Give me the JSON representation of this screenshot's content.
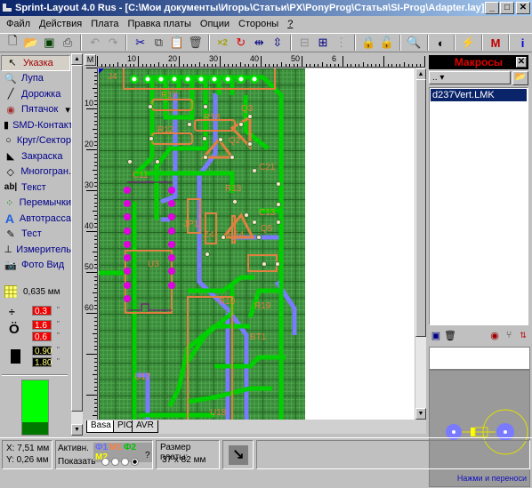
{
  "window": {
    "title": "Sprint-Layout 4.0 Rus - [C:\\Мои документы\\Игорь\\Статьи\\PX\\PonyProg\\Статья\\SI-Prog\\Adapter.lay]",
    "minimize": "_",
    "maximize": "□",
    "close": "✕"
  },
  "menu": [
    "Файл",
    "Действия",
    "Плата",
    "Правка платы",
    "Опции",
    "Стороны",
    "?"
  ],
  "toolbar": [
    {
      "name": "new-file-icon",
      "glyph": "🗋",
      "color": "#000000"
    },
    {
      "name": "open-folder-icon",
      "glyph": "📂",
      "color": "#c8a000"
    },
    {
      "name": "save-icon",
      "glyph": "▣",
      "color": "#004000"
    },
    {
      "name": "print-icon",
      "glyph": "⎙",
      "color": "#404040"
    },
    {
      "name": "undo-icon",
      "glyph": "↶",
      "color": "#909090"
    },
    {
      "name": "redo-icon",
      "glyph": "↷",
      "color": "#909090"
    },
    {
      "name": "cut-icon",
      "glyph": "✂",
      "color": "#0000a0"
    },
    {
      "name": "copy-icon",
      "glyph": "⧉",
      "color": "#404040"
    },
    {
      "name": "paste-icon",
      "glyph": "📋",
      "color": "#909090"
    },
    {
      "name": "delete-icon",
      "glyph": "🗑",
      "color": "#404040"
    },
    {
      "name": "duplicate-x2-icon",
      "glyph": "×2",
      "color": "#a0a000"
    },
    {
      "name": "rotate-icon",
      "glyph": "↻",
      "color": "#e00000"
    },
    {
      "name": "mirror-horizontal-icon",
      "glyph": "⇹",
      "color": "#000080"
    },
    {
      "name": "mirror-vertical-icon",
      "glyph": "⇳",
      "color": "#000080"
    },
    {
      "name": "align-icon",
      "glyph": "⊟",
      "color": "#909090"
    },
    {
      "name": "group-icon",
      "glyph": "⊞",
      "color": "#000080"
    },
    {
      "name": "ungroup-icon",
      "glyph": "⋮",
      "color": "#909090"
    },
    {
      "name": "lock-disabled-icon",
      "glyph": "🔒",
      "color": "#909090"
    },
    {
      "name": "unlock-icon",
      "glyph": "🔓",
      "color": "#404040"
    },
    {
      "name": "zoom-icon",
      "glyph": "🔍",
      "color": "#c0c000"
    },
    {
      "name": "contrast-icon",
      "glyph": "◐",
      "color": "#000000"
    },
    {
      "name": "autoroute-icon",
      "glyph": "⚡",
      "color": "#008000"
    },
    {
      "name": "macro-icon",
      "glyph": "M",
      "color": "#c00000"
    },
    {
      "name": "info-icon",
      "glyph": "i",
      "color": "#0000e0"
    }
  ],
  "tools": [
    {
      "label": "Указка",
      "icon": "pointer-icon",
      "glyph": "↖",
      "active": true
    },
    {
      "label": "Лупа",
      "icon": "magnifier-icon",
      "glyph": "🔍"
    },
    {
      "label": "Дорожка",
      "icon": "track-icon",
      "glyph": "╱"
    },
    {
      "label": "Пятачок",
      "icon": "pad-icon",
      "glyph": "◉",
      "dropdown": "▾"
    },
    {
      "label": "SMD-Контакт",
      "icon": "smd-pad-icon",
      "glyph": "▮"
    },
    {
      "label": "Круг/Сектор",
      "icon": "circle-icon",
      "glyph": "○"
    },
    {
      "label": "Закраска",
      "icon": "fill-icon",
      "glyph": "◣"
    },
    {
      "label": "Многогран.",
      "icon": "polygon-icon",
      "glyph": "◇"
    },
    {
      "label": "Текст",
      "icon": "text-icon",
      "glyph": "ab|"
    },
    {
      "label": "Перемычки",
      "icon": "jumper-icon",
      "glyph": "⁘"
    },
    {
      "label": "Автотрасса",
      "icon": "autoroute-tool-icon",
      "glyph": "A"
    },
    {
      "label": "Тест",
      "icon": "test-probe-icon",
      "glyph": "✎"
    },
    {
      "label": "Измеритель",
      "icon": "measure-icon",
      "glyph": "⊥"
    },
    {
      "label": "Фото Вид",
      "icon": "camera-icon",
      "glyph": "📷"
    }
  ],
  "params": {
    "grid": "0,635 мм",
    "track_width": "0.3",
    "pad_outer": "1.6",
    "pad_inner": "0.6",
    "smd_width": "0.90",
    "smd_height": "1.80",
    "unit_mark": "\""
  },
  "ruler": {
    "m_button": "M",
    "h_labels": [
      "10",
      "20",
      "30",
      "40",
      "50",
      "6"
    ],
    "v_labels": [
      "10",
      "20",
      "30",
      "40",
      "50",
      "60"
    ]
  },
  "board": {
    "components": [
      "J4",
      "R17",
      "R18",
      "R12",
      "Q3",
      "Q2",
      "C11",
      "R13",
      "C21",
      "C13",
      "JP1",
      "Z4",
      "R14",
      "Q5",
      "U3",
      "R10",
      "R19",
      "BT1",
      "U17",
      "U18"
    ]
  },
  "board_tabs": [
    "Basa",
    "PIC",
    "AVR"
  ],
  "macro_panel": {
    "title": "Макросы",
    "close": "✕",
    "path_select": "..",
    "items": [
      "d237Vert.LMK"
    ],
    "hint": "Нажми и переноси"
  },
  "status": {
    "x": "X: 7,51 мм",
    "y": "Y: 0,26 мм",
    "active_label": "Активн.",
    "show_label": "Показать",
    "layers": [
      {
        "label": "Ф1",
        "color": "#6a6aff"
      },
      {
        "label": "М1",
        "color": "#ff8040"
      },
      {
        "label": "Ф2",
        "color": "#00c000"
      },
      {
        "label": "М2",
        "color": "#ffff00"
      }
    ],
    "show_selected": 3,
    "help": "?",
    "board_size_label": "Размер платы:",
    "board_size": "37 x 82 мм"
  },
  "colors": {
    "title_start": "#0a246a",
    "board_bg": "#3a8a3a",
    "copper_top": "#00d000",
    "copper_bottom": "#7a7aff",
    "silkscreen": "#e08040",
    "pads_magenta": "#e000e0"
  }
}
